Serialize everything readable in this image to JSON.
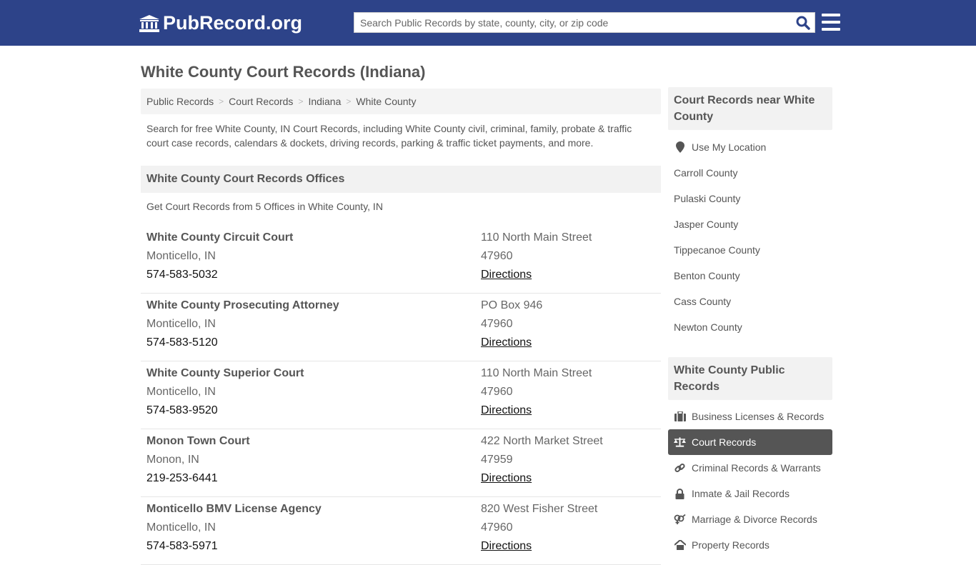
{
  "header": {
    "logo_text": "PubRecord.org",
    "search_placeholder": "Search Public Records by state, county, city, or zip code"
  },
  "page_title": "White County Court Records (Indiana)",
  "breadcrumb": [
    "Public Records",
    "Court Records",
    "Indiana",
    "White County"
  ],
  "intro": "Search for free White County, IN Court Records, including White County civil, criminal, family, probate & traffic court case records, calendars & dockets, driving records, parking & traffic ticket payments, and more.",
  "offices_section": {
    "title": "White County Court Records Offices",
    "subtitle": "Get Court Records from 5 Offices in White County, IN",
    "directions_label": "Directions",
    "offices": [
      {
        "name": "White County Circuit Court",
        "city": "Monticello, IN",
        "phone": "574-583-5032",
        "address": "110 North Main Street",
        "zip": "47960"
      },
      {
        "name": "White County Prosecuting Attorney",
        "city": "Monticello, IN",
        "phone": "574-583-5120",
        "address": "PO Box 946",
        "zip": "47960"
      },
      {
        "name": "White County Superior Court",
        "city": "Monticello, IN",
        "phone": "574-583-9520",
        "address": "110 North Main Street",
        "zip": "47960"
      },
      {
        "name": "Monon Town Court",
        "city": "Monon, IN",
        "phone": "219-253-6441",
        "address": "422 North Market Street",
        "zip": "47959"
      },
      {
        "name": "Monticello BMV License Agency",
        "city": "Monticello, IN",
        "phone": "574-583-5971",
        "address": "820 West Fisher Street",
        "zip": "47960"
      }
    ]
  },
  "sidebar": {
    "nearby_title": "Court Records near White County",
    "use_location": "Use My Location",
    "nearby": [
      "Carroll County",
      "Pulaski County",
      "Jasper County",
      "Tippecanoe County",
      "Benton County",
      "Cass County",
      "Newton County"
    ],
    "public_title": "White County Public Records",
    "public_links": [
      {
        "label": "Business Licenses & Records",
        "icon": "briefcase-icon"
      },
      {
        "label": "Court Records",
        "icon": "scale-icon",
        "active": true
      },
      {
        "label": "Criminal Records & Warrants",
        "icon": "link-icon"
      },
      {
        "label": "Inmate & Jail Records",
        "icon": "lock-icon"
      },
      {
        "label": "Marriage & Divorce Records",
        "icon": "venus-mars-icon"
      },
      {
        "label": "Property Records",
        "icon": "home-icon"
      }
    ]
  }
}
